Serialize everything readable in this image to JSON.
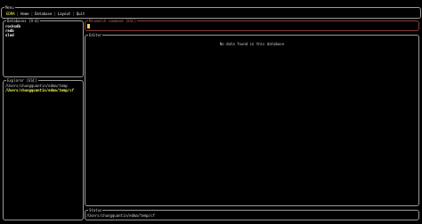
{
  "menu": {
    "title": "Menu",
    "items": [
      {
        "label": "EDMA",
        "active": true
      },
      {
        "label": "Home",
        "active": false
      },
      {
        "label": "Database",
        "active": false
      },
      {
        "label": "Layout",
        "active": false
      },
      {
        "label": "Quit",
        "active": false
      }
    ]
  },
  "databases": {
    "title": "Databases [9-0]",
    "items": [
      "rocksdb",
      "redb",
      "sled"
    ]
  },
  "explorer": {
    "title": "Explorer [ESC]",
    "items": [
      "/Users/chungquantin/edma/temp",
      "/Users/chungquantin/edma/temp/cf"
    ]
  },
  "command": {
    "title": "Mismatch command [ESC]"
  },
  "editor": {
    "title": "Editor",
    "empty_message": "No data found in this database"
  },
  "status": {
    "title": "Status",
    "text": "/Users/chungquantin/edma/temp/cf"
  },
  "colors": {
    "background": "#000000",
    "border": "#9a9a9a",
    "accent_yellow": "#f3f35a",
    "command_border": "#8a3a3a"
  }
}
